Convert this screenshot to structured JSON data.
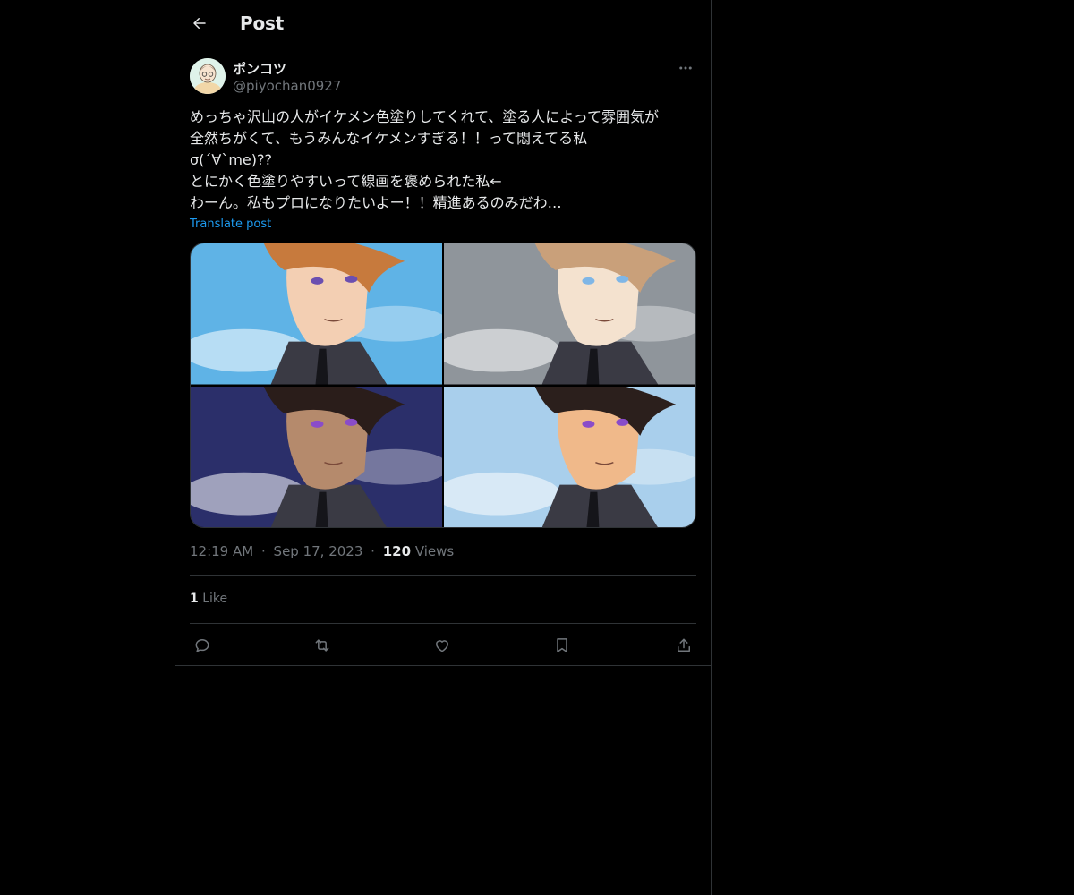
{
  "header": {
    "title": "Post",
    "back_icon": "arrow-left-icon"
  },
  "author": {
    "display_name": "ポンコツ",
    "handle": "@piyochan0927",
    "avatar_icon": "avatar-illustration",
    "more_icon": "more-horizontal-icon"
  },
  "post": {
    "lines": [
      "めっちゃ沢山の人がイケメン色塗りしてくれて、塗る人によって雰囲気が",
      "全然ちがくて、もうみんなイケメンすぎる！！って悶えてる私",
      "σ(´∀`me)??",
      "とにかく色塗りやすいって線画を褒められた私←",
      "わーん。私もプロになりたいよー！！精進あるのみだわ…"
    ],
    "translate_label": "Translate post"
  },
  "media": [
    {
      "name": "image-1",
      "bg": "#5fb3e6",
      "hair": "#c77a3d",
      "skin": "#f3cfb3",
      "eye": "#6b4fb0"
    },
    {
      "name": "image-2",
      "bg": "#8f959b",
      "hair": "#c9a07a",
      "skin": "#f4e2cf",
      "eye": "#7fb6e6"
    },
    {
      "name": "image-3",
      "bg": "#2b2f6a",
      "hair": "#2a1d1a",
      "skin": "#b58a6c",
      "eye": "#8a4cc9"
    },
    {
      "name": "image-4",
      "bg": "#a9cfec",
      "hair": "#2b1f1c",
      "skin": "#f0b98a",
      "eye": "#8a4cc9"
    }
  ],
  "meta": {
    "time": "12:19 AM",
    "separator": "·",
    "date": "Sep 17, 2023",
    "views_count": "120",
    "views_label": "Views"
  },
  "stats": {
    "likes_count": "1",
    "likes_label": "Like"
  },
  "actions": [
    {
      "name": "reply",
      "icon": "reply-icon"
    },
    {
      "name": "repost",
      "icon": "repost-icon"
    },
    {
      "name": "like",
      "icon": "heart-icon"
    },
    {
      "name": "bookmark",
      "icon": "bookmark-icon"
    },
    {
      "name": "share",
      "icon": "share-icon"
    }
  ],
  "colors": {
    "background": "#000000",
    "border": "#2f3336",
    "text_primary": "#e7e9ea",
    "text_secondary": "#71767b",
    "link": "#1d9bf0"
  }
}
